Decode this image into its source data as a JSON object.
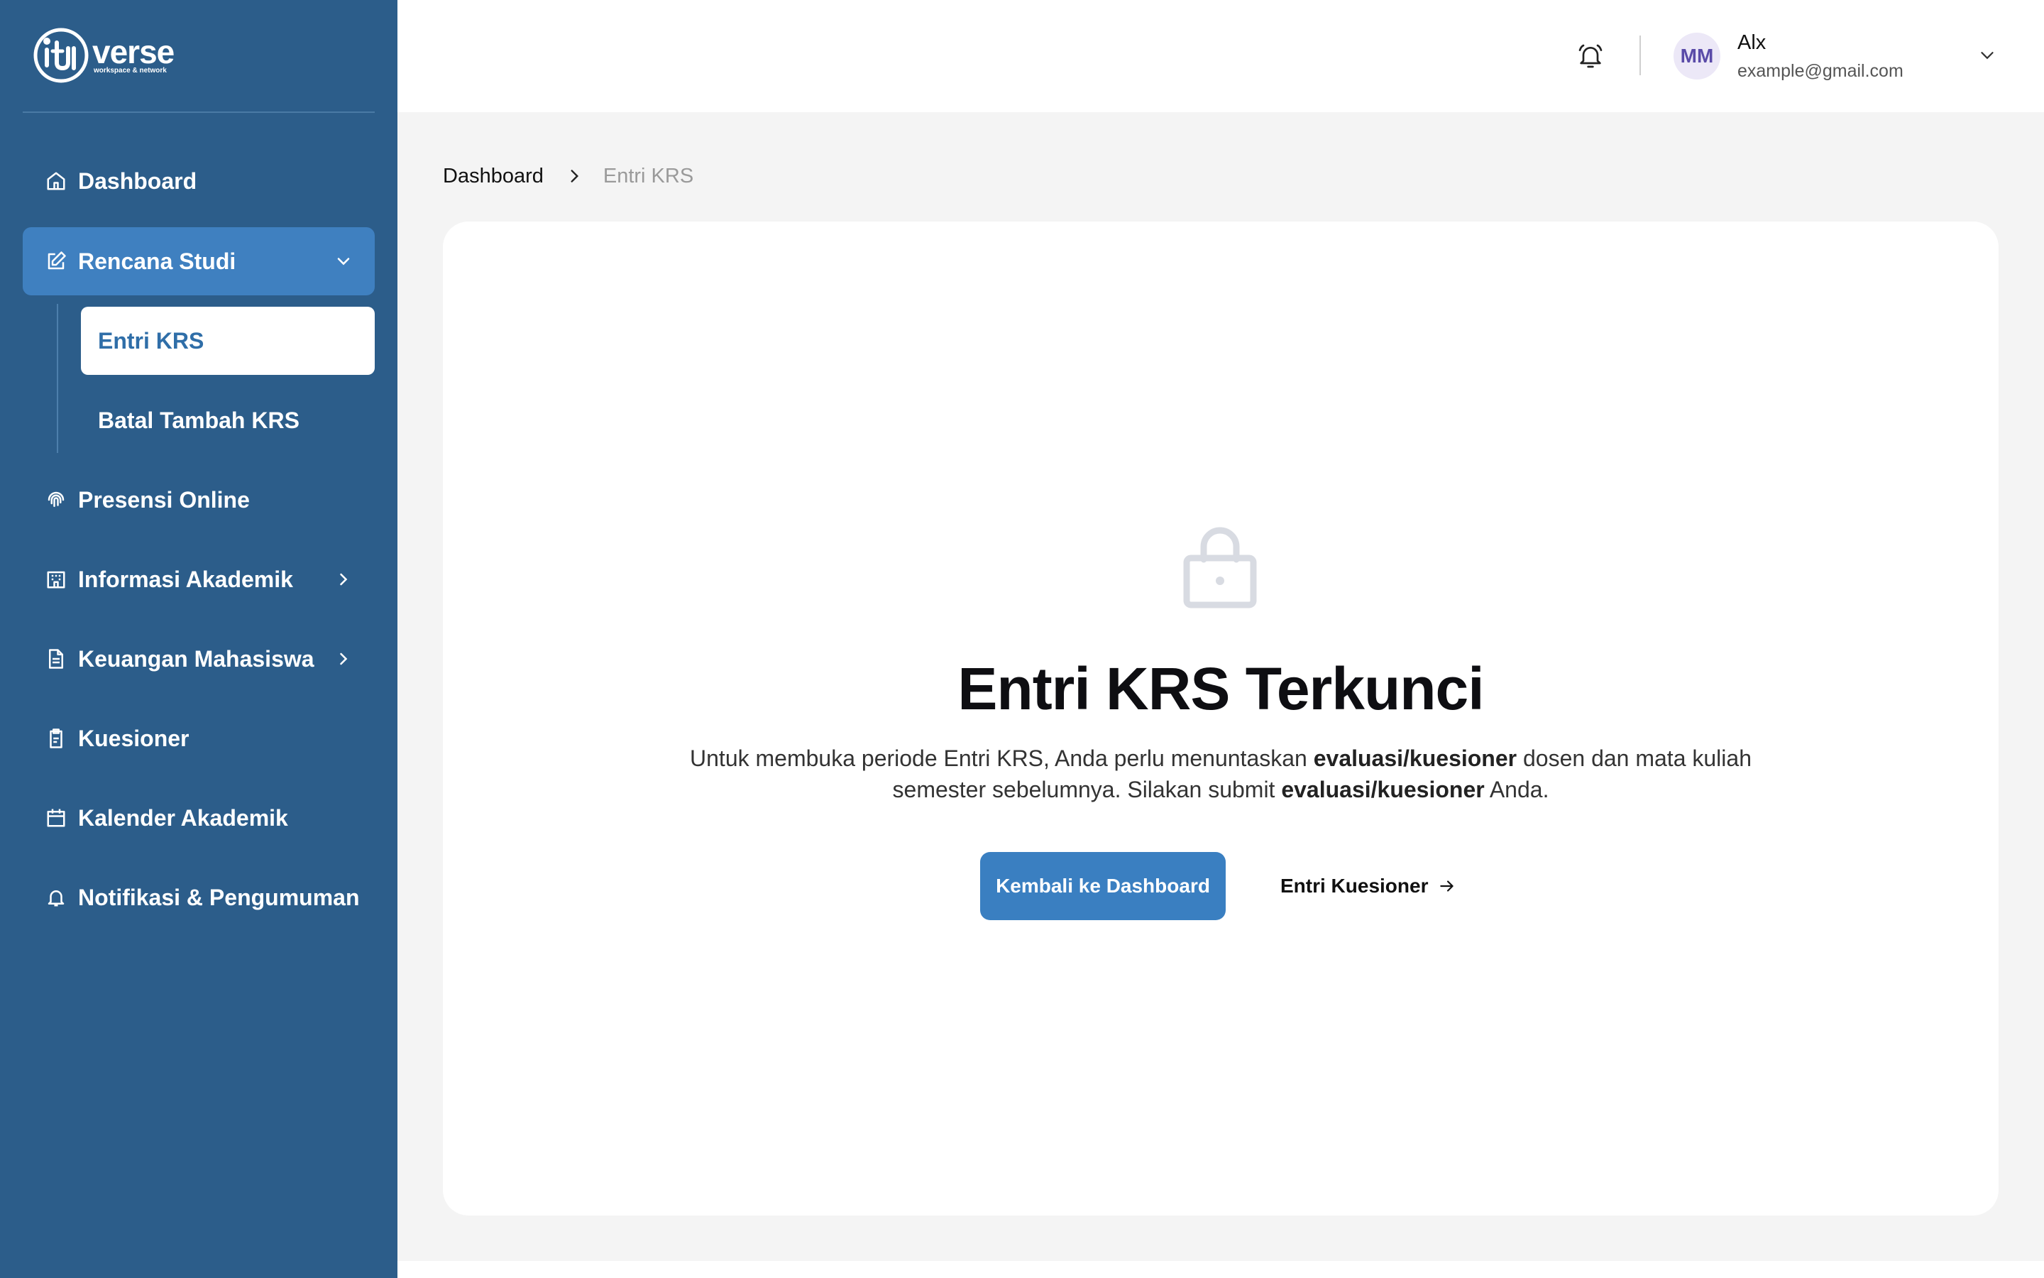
{
  "brand": {
    "logo_word": "verse",
    "logo_tagline": "workspace & network"
  },
  "sidebar": {
    "items": [
      {
        "label": "Dashboard",
        "icon": "home-icon"
      },
      {
        "label": "Rencana Studi",
        "icon": "edit-icon",
        "expanded": true,
        "children": [
          {
            "label": "Entri KRS",
            "selected": true
          },
          {
            "label": "Batal Tambah KRS"
          }
        ]
      },
      {
        "label": "Presensi Online",
        "icon": "fingerprint-icon"
      },
      {
        "label": "Informasi Akademik",
        "icon": "building-icon"
      },
      {
        "label": "Keuangan Mahasiswa",
        "icon": "document-icon"
      },
      {
        "label": "Kuesioner",
        "icon": "clipboard-icon"
      },
      {
        "label": "Kalender Akademik",
        "icon": "calendar-icon"
      },
      {
        "label": "Notifikasi & Pengumuman",
        "icon": "bell-icon"
      }
    ]
  },
  "header": {
    "user": {
      "initials": "MM",
      "name": "Alx",
      "email": "example@gmail.com"
    }
  },
  "breadcrumb": {
    "home": "Dashboard",
    "current": "Entri KRS"
  },
  "main": {
    "title": "Entri KRS Terkunci",
    "desc_part1": "Untuk membuka periode Entri KRS, Anda perlu menuntaskan ",
    "desc_bold1": "evaluasi/kuesioner",
    "desc_part2": " dosen dan mata kuliah semester sebelumnya. Silakan submit ",
    "desc_bold2": "evaluasi/kuesioner",
    "desc_part3": " Anda.",
    "primary_button": "Kembali ke Dashboard",
    "secondary_button": "Entri Kuesioner"
  },
  "colors": {
    "sidebar_bg": "#2c5d8a",
    "accent": "#3a7fc1",
    "active_nav": "#3f80c0"
  }
}
